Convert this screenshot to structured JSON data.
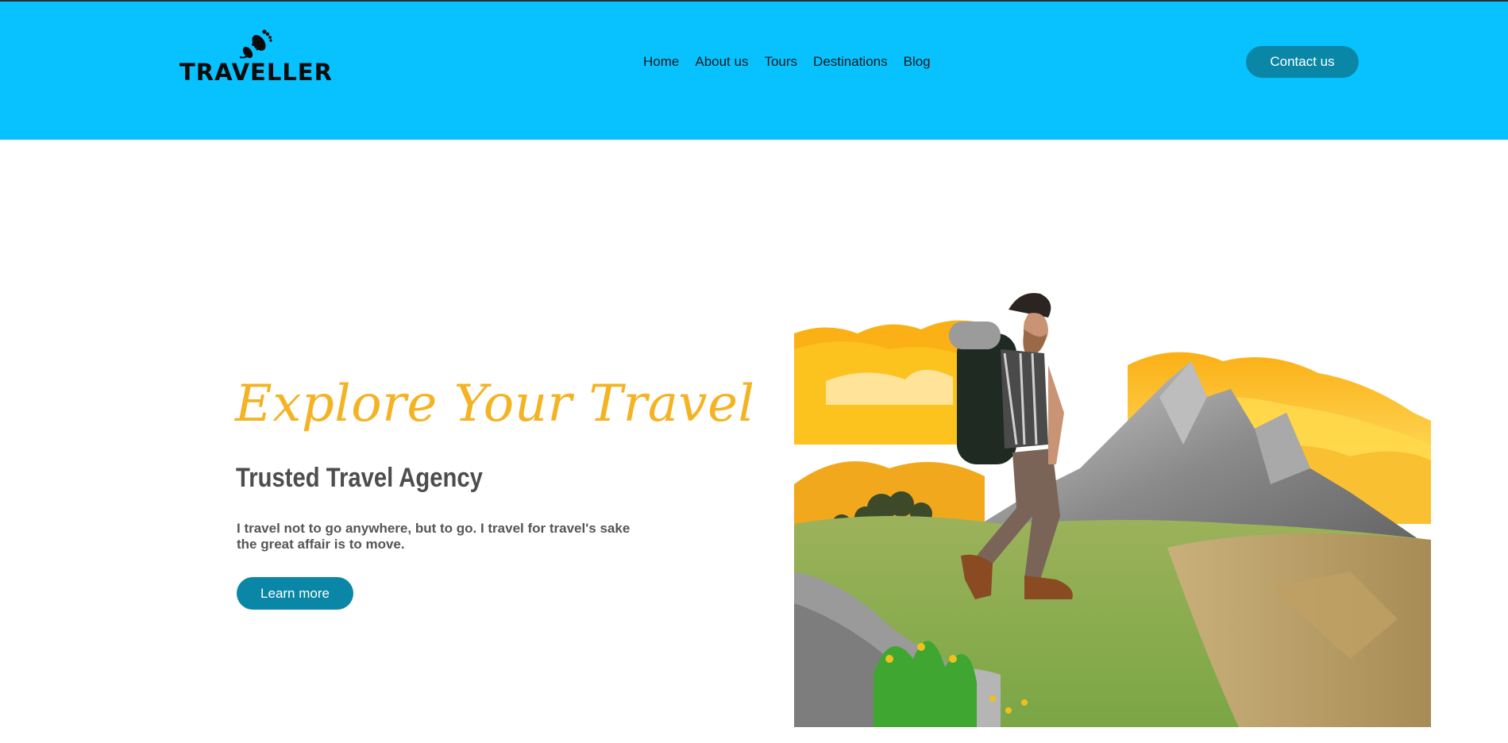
{
  "header": {
    "logo_text": "TRAVELLER",
    "nav": [
      {
        "label": "Home"
      },
      {
        "label": "About us"
      },
      {
        "label": "Tours"
      },
      {
        "label": "Destinations"
      },
      {
        "label": "Blog"
      }
    ],
    "contact_label": "Contact us",
    "background": "#08c2ff"
  },
  "hero": {
    "title": "Explore Your Travel",
    "subtitle": "Trusted Travel Agency",
    "text": "I travel not to go anywhere, but to go. I travel for travel's sake the great affair is to move.",
    "button_label": "Learn more",
    "title_color": "#f4b322",
    "button_color": "#0a87a6"
  },
  "icons": [
    "footprints-icon"
  ]
}
